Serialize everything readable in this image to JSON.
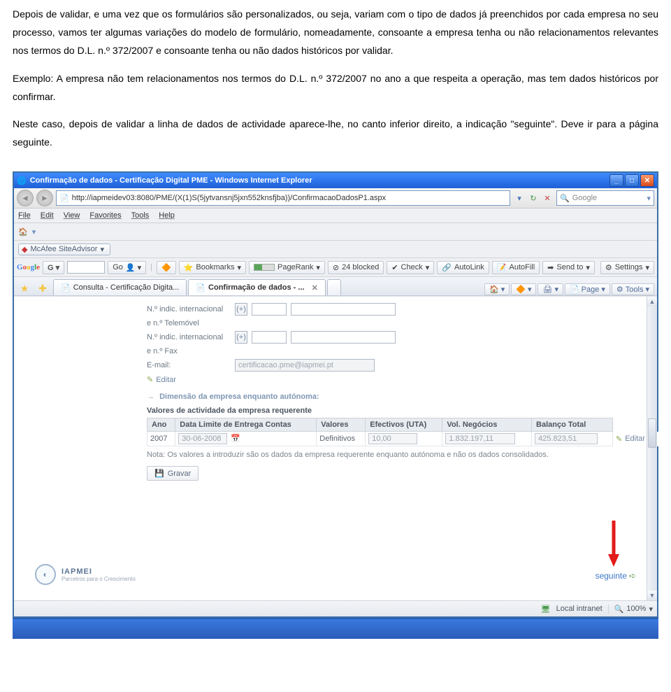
{
  "doc": {
    "p1": "Depois de validar, e uma vez que os formulários são personalizados, ou seja, variam com o tipo de dados já preenchidos por cada empresa no seu processo, vamos ter algumas variações do modelo de formulário, nomeadamente, consoante a empresa tenha ou não relacionamentos relevantes nos termos do D.L. n.º 372/2007 e consoante tenha ou não dados históricos por validar.",
    "p2a": "Exemplo: A empresa não tem relacionamentos nos termos do D.L. n.º 372/2007 no ano a que respeita a operação, mas tem dados históricos por confirmar.",
    "p2b": "Neste caso, depois de validar a linha de dados de actividade aparece-lhe, no canto inferior direito, a indicação \"seguinte\". Deve ir para a página seguinte."
  },
  "browser": {
    "title": "Confirmação de dados - Certificação Digital PME - Windows Internet Explorer",
    "url": "http://iapmeidev03:8080/PME/(X(1)S(5jytvansnj5jxn552knsfjba))/ConfirmacaoDadosP1.aspx",
    "search_placeholder": "Google",
    "menu": {
      "file": "File",
      "edit": "Edit",
      "view": "View",
      "favorites": "Favorites",
      "tools": "Tools",
      "help": "Help"
    },
    "siteadvisor": "McAfee SiteAdvisor",
    "gbar": {
      "go": "Go",
      "bookmarks": "Bookmarks",
      "pagerank": "PageRank",
      "blocked": "24 blocked",
      "check": "Check",
      "autolink": "AutoLink",
      "autofill": "AutoFill",
      "sendto": "Send to",
      "settings": "Settings"
    },
    "tabs": {
      "t1": "Consulta - Certificação Digita...",
      "t2": "Confirmação de dados - ..."
    },
    "tabtools": {
      "home": "",
      "feeds": "",
      "print": "",
      "page": "Page",
      "tools": "Tools"
    },
    "status": {
      "zone": "Local intranet",
      "zoom": "100%"
    }
  },
  "form": {
    "row_indic": "N.º indic. internacional",
    "row_tel": "e n.º Telemóvel",
    "row_fax": "e n.º Fax",
    "row_email_label": "E-mail:",
    "row_email_value": "certificacao.pme@iapmei.pt",
    "editar": "Editar",
    "dimensao": "Dimensão da empresa enquanto autónoma:",
    "valores_head": "Valores de actividade da empresa requerente",
    "cols": {
      "ano": "Ano",
      "data": "Data Limite de Entrega Contas",
      "valores": "Valores",
      "efectivos": "Efectivos (UTA)",
      "vneg": "Vol. Negócios",
      "balanco": "Balanço Total"
    },
    "row": {
      "ano": "2007",
      "data": "30-06-2008",
      "valores": "Definitivos",
      "efectivos": "10,00",
      "vneg": "1.832.197,11",
      "balanco": "425.823,51"
    },
    "nota": "Nota: Os valores a introduzir são os dados da empresa requerente enquanto autónoma e não os dados consolidados.",
    "gravar": "Gravar",
    "iapmei": "IAPMEI",
    "iapmei_sub": "Parceiros para o Crescimento",
    "seguinte": "seguinte"
  }
}
